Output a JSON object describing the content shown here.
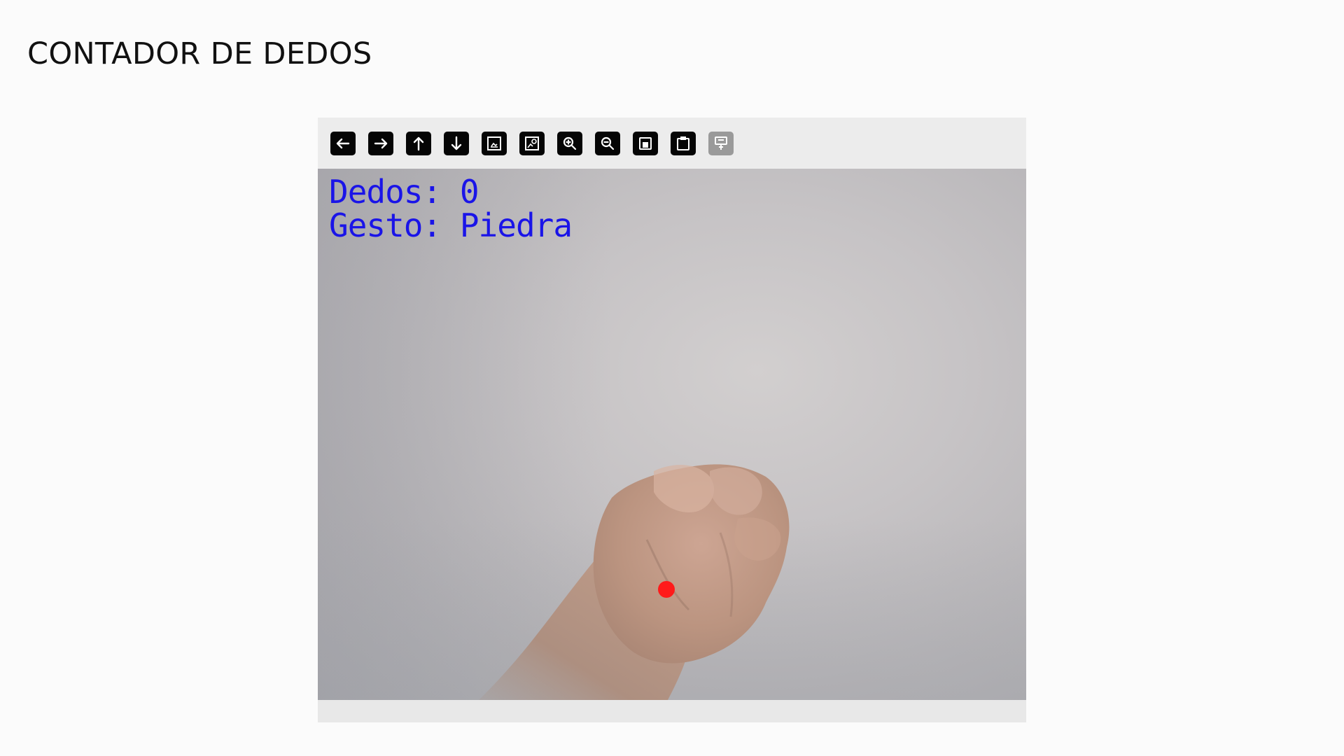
{
  "page": {
    "title": "CONTADOR DE DEDOS"
  },
  "viewer": {
    "toolbar": {
      "buttons": [
        {
          "icon": "arrow-left-icon",
          "enabled": true
        },
        {
          "icon": "arrow-right-icon",
          "enabled": true
        },
        {
          "icon": "arrow-up-icon",
          "enabled": true
        },
        {
          "icon": "arrow-down-icon",
          "enabled": true
        },
        {
          "icon": "image-icon",
          "enabled": true
        },
        {
          "icon": "image-properties-icon",
          "enabled": true
        },
        {
          "icon": "zoom-in-icon",
          "enabled": true
        },
        {
          "icon": "zoom-out-icon",
          "enabled": true
        },
        {
          "icon": "save-icon",
          "enabled": true
        },
        {
          "icon": "clipboard-icon",
          "enabled": true
        },
        {
          "icon": "properties-icon",
          "enabled": false
        }
      ]
    },
    "frame": {
      "count_text": "Dedos: 0",
      "gesture_text": "Gesto: Piedra",
      "overlay_color": "#1a14e8",
      "marker_color": "#ff1a1a"
    }
  }
}
